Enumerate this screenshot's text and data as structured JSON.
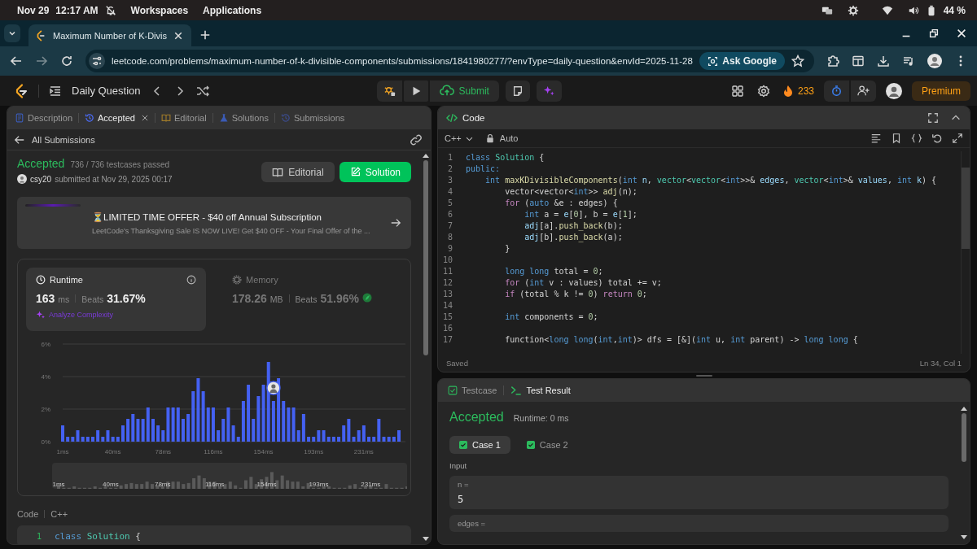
{
  "system_bar": {
    "date": "Nov 29",
    "time": "12:17 AM",
    "menus": [
      "Workspaces",
      "Applications"
    ],
    "battery": "44 %"
  },
  "browser": {
    "tab_title": "Maximum Number of K-Divis",
    "url": "leetcode.com/problems/maximum-number-of-k-divisible-components/submissions/1841980277/?envType=daily-question&envId=2025-11-28",
    "ask_button": "Ask Google"
  },
  "nav": {
    "title": "Daily Question",
    "submit_button": "Submit",
    "streak": "233",
    "premium_button": "Premium"
  },
  "left_panel": {
    "tabs": [
      {
        "label": "Description",
        "selected": false,
        "closable": false
      },
      {
        "label": "Accepted",
        "selected": true,
        "closable": true
      },
      {
        "label": "Editorial",
        "selected": false,
        "closable": false
      },
      {
        "label": "Solutions",
        "selected": false,
        "closable": false
      },
      {
        "label": "Submissions",
        "selected": false,
        "closable": false
      }
    ],
    "back_link": "All Submissions",
    "status": "Accepted",
    "testcases": "736 / 736 testcases passed",
    "user": "csy20",
    "submitted": "submitted at Nov 29, 2025 00:17",
    "buttons": [
      {
        "label": "Editorial",
        "kind": "secondary"
      },
      {
        "label": "Solution",
        "kind": "primary"
      }
    ],
    "promo": {
      "title": "⏳LIMITED TIME OFFER - $40 off Annual Subscription",
      "text": "LeetCode's Thanksgiving Sale IS NOW LIVE! Get $40 OFF - Your Final Offer of the ..."
    },
    "stats": [
      {
        "label": "Runtime",
        "value": "163",
        "unit": "ms",
        "beats_label": "Beats",
        "beats": "31.67%",
        "selected": true,
        "link": "Analyze Complexity"
      },
      {
        "label": "Memory",
        "value": "178.26",
        "unit": "MB",
        "beats_label": "Beats",
        "beats": "51.96%",
        "selected": false
      }
    ],
    "chart_data": {
      "type": "bar",
      "categories": [
        "1ms",
        null,
        null,
        null,
        null,
        null,
        null,
        null,
        null,
        null,
        "40ms",
        null,
        null,
        null,
        null,
        null,
        null,
        null,
        null,
        null,
        "78ms",
        null,
        null,
        null,
        null,
        null,
        null,
        null,
        null,
        null,
        "116ms",
        null,
        null,
        null,
        null,
        null,
        null,
        null,
        null,
        null,
        "154ms",
        null,
        null,
        null,
        null,
        null,
        null,
        null,
        null,
        null,
        "193ms",
        null,
        null,
        null,
        null,
        null,
        null,
        null,
        null,
        null,
        "231ms",
        null,
        null,
        null,
        null,
        null,
        null,
        null
      ],
      "values": [
        1.0,
        0.3,
        0.3,
        0.7,
        0.3,
        0.3,
        0.3,
        0.7,
        0.3,
        0.7,
        0.3,
        0.3,
        1.0,
        1.4,
        1.7,
        1.4,
        1.4,
        2.1,
        1.4,
        1.0,
        0.7,
        2.1,
        2.1,
        2.1,
        1.4,
        1.7,
        3.1,
        3.9,
        3.1,
        2.1,
        2.1,
        0.7,
        1.4,
        2.1,
        1.0,
        0.3,
        2.5,
        3.5,
        1.4,
        2.8,
        3.5,
        4.9,
        2.5,
        3.9,
        2.5,
        2.1,
        2.1,
        0.7,
        1.7,
        0.3,
        0.3,
        0.7,
        0.7,
        0.3,
        0.3,
        0.3,
        1.0,
        1.4,
        0.3,
        0.7,
        1.0,
        0.3,
        0.3,
        1.4,
        0.3,
        0.3,
        0.3,
        0.7
      ],
      "ylim": [
        0,
        6
      ],
      "yticks": [
        {
          "value": 0,
          "label": "0%"
        },
        {
          "value": 2,
          "label": "2%"
        },
        {
          "value": 4,
          "label": "4%"
        },
        {
          "value": 6,
          "label": "6%"
        }
      ]
    },
    "overview_labels": [
      "1ms",
      "40ms",
      "78ms",
      "116ms",
      "154ms",
      "193ms",
      "231ms"
    ],
    "code_header": {
      "label": "Code",
      "language": "C++"
    },
    "code_preview": [
      {
        "number": "1",
        "tokens": [
          {
            "kind": "kw",
            "text": "class"
          },
          {
            "kind": "ty",
            "text": " Solution"
          },
          {
            "kind": "p",
            "text": " {"
          }
        ]
      }
    ]
  },
  "code_panel": {
    "title": "Code",
    "language": "C++",
    "mode": "Auto",
    "lines": [
      {
        "number": "1",
        "tokens": [
          {
            "kind": "kw",
            "text": "class"
          },
          {
            "kind": "ty",
            "text": " Solution"
          },
          {
            "kind": "p",
            "text": " {"
          }
        ]
      },
      {
        "number": "2",
        "tokens": [
          {
            "kind": "kw",
            "text": "public:"
          }
        ]
      },
      {
        "number": "3",
        "tokens": [
          {
            "kind": "kw",
            "text": "    int"
          },
          {
            "kind": "fn",
            "text": " maxKDivisibleComponents"
          },
          {
            "kind": "p",
            "text": "("
          },
          {
            "kind": "kw",
            "text": "int"
          },
          {
            "kind": "var",
            "text": " n"
          },
          {
            "kind": "p",
            "text": ", "
          },
          {
            "kind": "ty",
            "text": "vector"
          },
          {
            "kind": "p",
            "text": "<"
          },
          {
            "kind": "ty",
            "text": "vector"
          },
          {
            "kind": "p",
            "text": "<"
          },
          {
            "kind": "kw",
            "text": "int"
          },
          {
            "kind": "p",
            "text": ">>& "
          },
          {
            "kind": "var",
            "text": "edges"
          },
          {
            "kind": "p",
            "text": ", "
          },
          {
            "kind": "ty",
            "text": "vector"
          },
          {
            "kind": "p",
            "text": "<"
          },
          {
            "kind": "kw",
            "text": "int"
          },
          {
            "kind": "p",
            "text": ">& "
          },
          {
            "kind": "var",
            "text": "values"
          },
          {
            "kind": "p",
            "text": ", "
          },
          {
            "kind": "kw",
            "text": "int"
          },
          {
            "kind": "var",
            "text": " k"
          },
          {
            "kind": "p",
            "text": ") {"
          }
        ]
      },
      {
        "number": "4",
        "tokens": [
          {
            "kind": "p",
            "text": "        vector<vector<"
          },
          {
            "kind": "kw",
            "text": "int"
          },
          {
            "kind": "p",
            "text": ">> "
          },
          {
            "kind": "fn",
            "text": "adj"
          },
          {
            "kind": "p",
            "text": "(n);"
          }
        ]
      },
      {
        "number": "5",
        "tokens": [
          {
            "kind": "ctrl",
            "text": "        for"
          },
          {
            "kind": "p",
            "text": " ("
          },
          {
            "kind": "kw",
            "text": "auto"
          },
          {
            "kind": "p",
            "text": " &e : edges) {"
          }
        ]
      },
      {
        "number": "6",
        "tokens": [
          {
            "kind": "kw",
            "text": "            int"
          },
          {
            "kind": "p",
            "text": " a = "
          },
          {
            "kind": "var",
            "text": "e"
          },
          {
            "kind": "p",
            "text": "["
          },
          {
            "kind": "num",
            "text": "0"
          },
          {
            "kind": "p",
            "text": "], b = "
          },
          {
            "kind": "var",
            "text": "e"
          },
          {
            "kind": "p",
            "text": "["
          },
          {
            "kind": "num",
            "text": "1"
          },
          {
            "kind": "p",
            "text": "];"
          }
        ]
      },
      {
        "number": "7",
        "tokens": [
          {
            "kind": "var",
            "text": "            adj"
          },
          {
            "kind": "p",
            "text": "[a]."
          },
          {
            "kind": "fn",
            "text": "push_back"
          },
          {
            "kind": "p",
            "text": "(b);"
          }
        ]
      },
      {
        "number": "8",
        "tokens": [
          {
            "kind": "var",
            "text": "            adj"
          },
          {
            "kind": "p",
            "text": "[b]."
          },
          {
            "kind": "fn",
            "text": "push_back"
          },
          {
            "kind": "p",
            "text": "(a);"
          }
        ]
      },
      {
        "number": "9",
        "tokens": [
          {
            "kind": "p",
            "text": "        }"
          }
        ]
      },
      {
        "number": "10"
      },
      {
        "number": "11",
        "tokens": [
          {
            "kind": "kw",
            "text": "        long long"
          },
          {
            "kind": "p",
            "text": " total = "
          },
          {
            "kind": "num",
            "text": "0"
          },
          {
            "kind": "p",
            "text": ";"
          }
        ]
      },
      {
        "number": "12",
        "tokens": [
          {
            "kind": "ctrl",
            "text": "        for"
          },
          {
            "kind": "p",
            "text": " ("
          },
          {
            "kind": "kw",
            "text": "int"
          },
          {
            "kind": "p",
            "text": " v : values) total += v;"
          }
        ]
      },
      {
        "number": "13",
        "tokens": [
          {
            "kind": "ctrl",
            "text": "        if"
          },
          {
            "kind": "p",
            "text": " (total % k != "
          },
          {
            "kind": "num",
            "text": "0"
          },
          {
            "kind": "p",
            "text": ") "
          },
          {
            "kind": "ctrl",
            "text": "return"
          },
          {
            "kind": "num",
            "text": " 0"
          },
          {
            "kind": "p",
            "text": ";"
          }
        ]
      },
      {
        "number": "14"
      },
      {
        "number": "15",
        "tokens": [
          {
            "kind": "kw",
            "text": "        int"
          },
          {
            "kind": "p",
            "text": " components = "
          },
          {
            "kind": "num",
            "text": "0"
          },
          {
            "kind": "p",
            "text": ";"
          }
        ]
      },
      {
        "number": "16"
      },
      {
        "number": "17",
        "tokens": [
          {
            "kind": "p",
            "text": "        function<"
          },
          {
            "kind": "kw",
            "text": "long long"
          },
          {
            "kind": "p",
            "text": "("
          },
          {
            "kind": "kw",
            "text": "int"
          },
          {
            "kind": "p",
            "text": ","
          },
          {
            "kind": "kw",
            "text": "int"
          },
          {
            "kind": "p",
            "text": ")> dfs = [&]("
          },
          {
            "kind": "kw",
            "text": "int"
          },
          {
            "kind": "p",
            "text": " u, "
          },
          {
            "kind": "kw",
            "text": "int"
          },
          {
            "kind": "p",
            "text": " parent) -> "
          },
          {
            "kind": "kw",
            "text": "long long"
          },
          {
            "kind": "p",
            "text": " {"
          }
        ]
      }
    ],
    "status": "Saved",
    "cursor": "Ln 34, Col 1"
  },
  "result_panel": {
    "tabs": [
      {
        "label": "Testcase",
        "selected": false
      },
      {
        "label": "Test Result",
        "selected": true
      }
    ],
    "status": "Accepted",
    "runtime": "Runtime: 0 ms",
    "cases": [
      {
        "label": "Case 1",
        "selected": true
      },
      {
        "label": "Case 2",
        "selected": false
      }
    ],
    "input_label": "Input",
    "params": [
      {
        "name": "n =",
        "value": "5"
      },
      {
        "name": "edges ="
      }
    ]
  }
}
